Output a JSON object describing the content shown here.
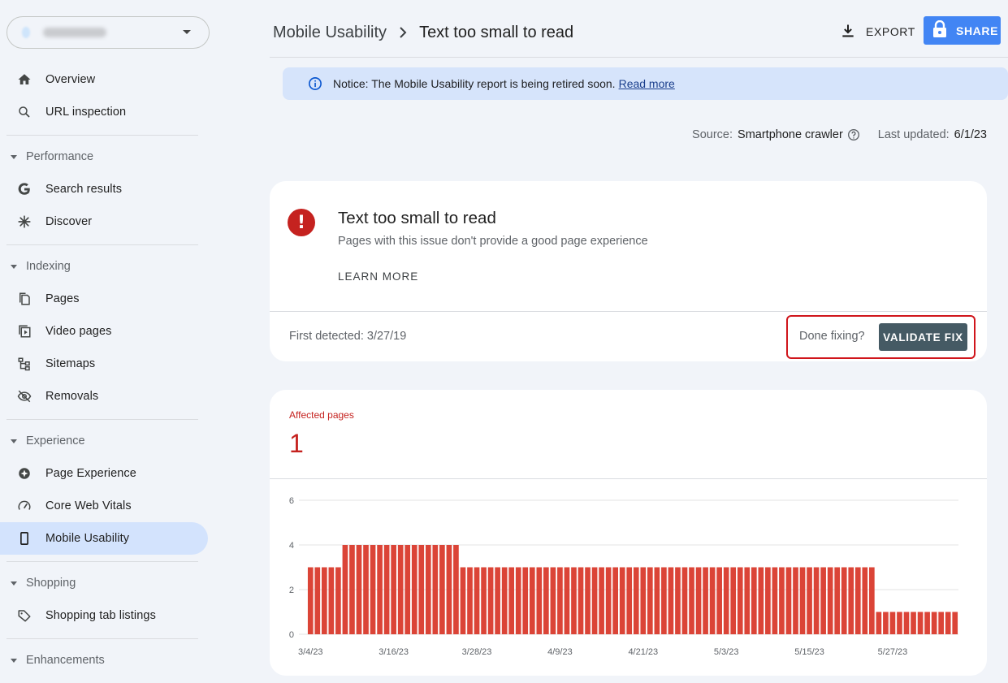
{
  "sidebar": {
    "items": [
      {
        "label": "Overview",
        "icon": "home-icon"
      },
      {
        "label": "URL inspection",
        "icon": "search-icon"
      },
      {
        "label": "Search results",
        "icon": "google-g-icon"
      },
      {
        "label": "Discover",
        "icon": "asterisk-icon"
      },
      {
        "label": "Pages",
        "icon": "pages-icon"
      },
      {
        "label": "Video pages",
        "icon": "video-pages-icon"
      },
      {
        "label": "Sitemaps",
        "icon": "sitemap-icon"
      },
      {
        "label": "Removals",
        "icon": "eye-off-icon"
      },
      {
        "label": "Page Experience",
        "icon": "page-experience-icon"
      },
      {
        "label": "Core Web Vitals",
        "icon": "gauge-icon"
      },
      {
        "label": "Mobile Usability",
        "icon": "phone-icon"
      },
      {
        "label": "Shopping tab listings",
        "icon": "tag-icon"
      }
    ],
    "sections": [
      "Performance",
      "Indexing",
      "Experience",
      "Shopping",
      "Enhancements"
    ]
  },
  "header": {
    "crumb1": "Mobile Usability",
    "crumb2": "Text too small to read",
    "export_label": "EXPORT",
    "share_label": "SHARE"
  },
  "notice": {
    "text": "Notice: The Mobile Usability report is being retired soon.",
    "link": "Read more"
  },
  "meta": {
    "source_label": "Source:",
    "source_value": "Smartphone crawler",
    "updated_label": "Last updated:",
    "updated_value": "6/1/23"
  },
  "issue": {
    "title": "Text too small to read",
    "description": "Pages with this issue don't provide a good page experience",
    "learn_more": "LEARN MORE",
    "first_detected": "First detected: 3/27/19",
    "done_fixing": "Done fixing?",
    "validate_label": "VALIDATE FIX"
  },
  "affected": {
    "label": "Affected pages",
    "value": "1"
  },
  "colors": {
    "bar": "#db4437",
    "accent": "#4285f4",
    "error": "#c5221f"
  },
  "chart_data": {
    "type": "bar",
    "x_tick_labels": [
      "3/4/23",
      "3/16/23",
      "3/28/23",
      "4/9/23",
      "4/21/23",
      "5/3/23",
      "5/15/23",
      "5/27/23"
    ],
    "y_ticks": [
      0,
      2,
      4,
      6
    ],
    "ylim": [
      0,
      6
    ],
    "x": [
      "3/4/23",
      "3/5/23",
      "3/6/23",
      "3/7/23",
      "3/8/23",
      "3/9/23",
      "3/10/23",
      "3/11/23",
      "3/12/23",
      "3/13/23",
      "3/14/23",
      "3/15/23",
      "3/16/23",
      "3/17/23",
      "3/18/23",
      "3/19/23",
      "3/20/23",
      "3/21/23",
      "3/22/23",
      "3/23/23",
      "3/24/23",
      "3/25/23",
      "3/26/23",
      "3/27/23",
      "3/28/23",
      "3/29/23",
      "3/30/23",
      "3/31/23",
      "4/1/23",
      "4/2/23",
      "4/3/23",
      "4/4/23",
      "4/5/23",
      "4/6/23",
      "4/7/23",
      "4/8/23",
      "4/9/23",
      "4/10/23",
      "4/11/23",
      "4/12/23",
      "4/13/23",
      "4/14/23",
      "4/15/23",
      "4/16/23",
      "4/17/23",
      "4/18/23",
      "4/19/23",
      "4/20/23",
      "4/21/23",
      "4/22/23",
      "4/23/23",
      "4/24/23",
      "4/25/23",
      "4/26/23",
      "4/27/23",
      "4/28/23",
      "4/29/23",
      "4/30/23",
      "5/1/23",
      "5/2/23",
      "5/3/23",
      "5/4/23",
      "5/5/23",
      "5/6/23",
      "5/7/23",
      "5/8/23",
      "5/9/23",
      "5/10/23",
      "5/11/23",
      "5/12/23",
      "5/13/23",
      "5/14/23",
      "5/15/23",
      "5/16/23",
      "5/17/23",
      "5/18/23",
      "5/19/23",
      "5/20/23",
      "5/21/23",
      "5/22/23",
      "5/23/23",
      "5/24/23",
      "5/25/23",
      "5/26/23",
      "5/27/23",
      "5/28/23",
      "5/29/23",
      "5/30/23",
      "5/31/23",
      "6/1/23"
    ],
    "values": [
      3,
      3,
      3,
      3,
      3,
      4,
      4,
      4,
      4,
      4,
      4,
      4,
      4,
      4,
      4,
      4,
      4,
      4,
      4,
      4,
      4,
      4,
      3,
      3,
      3,
      3,
      3,
      3,
      3,
      3,
      3,
      3,
      3,
      3,
      3,
      3,
      3,
      3,
      3,
      3,
      3,
      3,
      3,
      3,
      3,
      3,
      3,
      3,
      3,
      3,
      3,
      3,
      3,
      3,
      3,
      3,
      3,
      3,
      3,
      3,
      3,
      3,
      3,
      3,
      3,
      3,
      3,
      3,
      3,
      3,
      3,
      3,
      3,
      3,
      3,
      3,
      3,
      3,
      3,
      3,
      3,
      3,
      1,
      1,
      1,
      1,
      1,
      1,
      1,
      1,
      1,
      1,
      1,
      1
    ],
    "grid": true
  }
}
